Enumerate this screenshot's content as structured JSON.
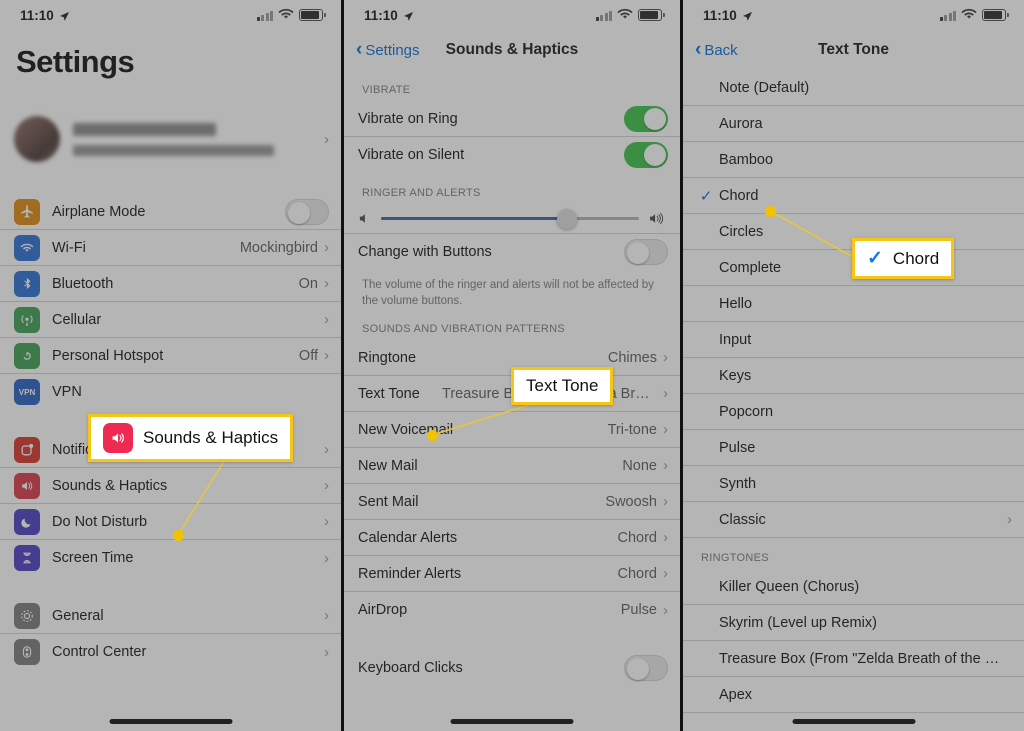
{
  "status_bar": {
    "time": "11:10",
    "location_icon": "location-arrow-icon",
    "wifi_icon": "wifi-icon",
    "signal_icon": "cellular-bars-icon",
    "battery_icon": "battery-icon"
  },
  "panel1": {
    "title": "Settings",
    "account": {
      "name_redacted": "",
      "subtitle_redacted": ""
    },
    "group_connectivity": [
      {
        "label": "Airplane Mode",
        "icon": "airplane-icon",
        "color": "#e08a10",
        "control": "toggle",
        "value": "off"
      },
      {
        "label": "Wi-Fi",
        "icon": "wifi-icon",
        "color": "#2a6fd4",
        "value": "Mockingbird"
      },
      {
        "label": "Bluetooth",
        "icon": "bluetooth-icon",
        "color": "#2a6fd4",
        "value": "On"
      },
      {
        "label": "Cellular",
        "icon": "cellular-icon",
        "color": "#3f9e55",
        "value": ""
      },
      {
        "label": "Personal Hotspot",
        "icon": "hotspot-icon",
        "color": "#3f9e55",
        "value": "Off"
      },
      {
        "label": "VPN",
        "icon": "vpn-icon",
        "color": "#2a5fc4",
        "value": ""
      }
    ],
    "group_alerts": [
      {
        "label": "Notifications",
        "icon": "notifications-icon",
        "color": "#d8342b"
      },
      {
        "label": "Sounds & Haptics",
        "icon": "sounds-icon",
        "color": "#d93b4a"
      },
      {
        "label": "Do Not Disturb",
        "icon": "moon-icon",
        "color": "#4b3fc4"
      },
      {
        "label": "Screen Time",
        "icon": "hourglass-icon",
        "color": "#4b3fc4"
      }
    ],
    "group_system": [
      {
        "label": "General",
        "icon": "gear-icon",
        "color": "#7b7b7b"
      },
      {
        "label": "Control Center",
        "icon": "control-center-icon",
        "color": "#7b7b7b"
      }
    ],
    "callout": {
      "label": "Sounds & Haptics",
      "icon": "sounds-icon",
      "color": "#ef2a52"
    }
  },
  "panel2": {
    "back_label": "Settings",
    "title": "Sounds & Haptics",
    "section_vibrate": "VIBRATE",
    "vibrate_rows": [
      {
        "label": "Vibrate on Ring",
        "state": "on"
      },
      {
        "label": "Vibrate on Silent",
        "state": "on"
      }
    ],
    "section_ringer": "RINGER AND ALERTS",
    "slider_percent": 72,
    "change_with_buttons": {
      "label": "Change with Buttons",
      "state": "off"
    },
    "footnote": "The volume of the ringer and alerts will not be affected by the volume buttons.",
    "section_sounds": "SOUNDS AND VIBRATION PATTERNS",
    "sound_rows": [
      {
        "label": "Ringtone",
        "value": "Chimes"
      },
      {
        "label": "Text Tone",
        "value": "Treasure Box (From \"Zelda Breath..."
      },
      {
        "label": "New Voicemail",
        "value": "Tri-tone"
      },
      {
        "label": "New Mail",
        "value": "None"
      },
      {
        "label": "Sent Mail",
        "value": "Swoosh"
      },
      {
        "label": "Calendar Alerts",
        "value": "Chord"
      },
      {
        "label": "Reminder Alerts",
        "value": "Chord"
      },
      {
        "label": "AirDrop",
        "value": "Pulse"
      }
    ],
    "keyboard_clicks": {
      "label": "Keyboard Clicks",
      "state": "off"
    },
    "callout": {
      "label": "Text Tone"
    }
  },
  "panel3": {
    "back_label": "Back",
    "title": "Text Tone",
    "alert_tones": [
      {
        "label": "Note (Default)",
        "checked": false
      },
      {
        "label": "Aurora",
        "checked": false
      },
      {
        "label": "Bamboo",
        "checked": false
      },
      {
        "label": "Chord",
        "checked": true
      },
      {
        "label": "Circles",
        "checked": false
      },
      {
        "label": "Complete",
        "checked": false
      },
      {
        "label": "Hello",
        "checked": false
      },
      {
        "label": "Input",
        "checked": false
      },
      {
        "label": "Keys",
        "checked": false
      },
      {
        "label": "Popcorn",
        "checked": false
      },
      {
        "label": "Pulse",
        "checked": false
      },
      {
        "label": "Synth",
        "checked": false
      },
      {
        "label": "Classic",
        "checked": false,
        "disclosure": true
      }
    ],
    "section_ringtones": "RINGTONES",
    "ringtones": [
      {
        "label": "Killer Queen (Chorus)"
      },
      {
        "label": "Skyrim (Level up Remix)"
      },
      {
        "label": "Treasure Box (From \"Zelda Breath of the Wi..."
      },
      {
        "label": "Apex"
      }
    ],
    "callout": {
      "label": "Chord",
      "check": "✓"
    }
  },
  "colors": {
    "highlight": "#f5c518",
    "accent_blue": "#0b6ed8",
    "toggle_green": "#3cc14b",
    "dot": "#f2c200"
  }
}
